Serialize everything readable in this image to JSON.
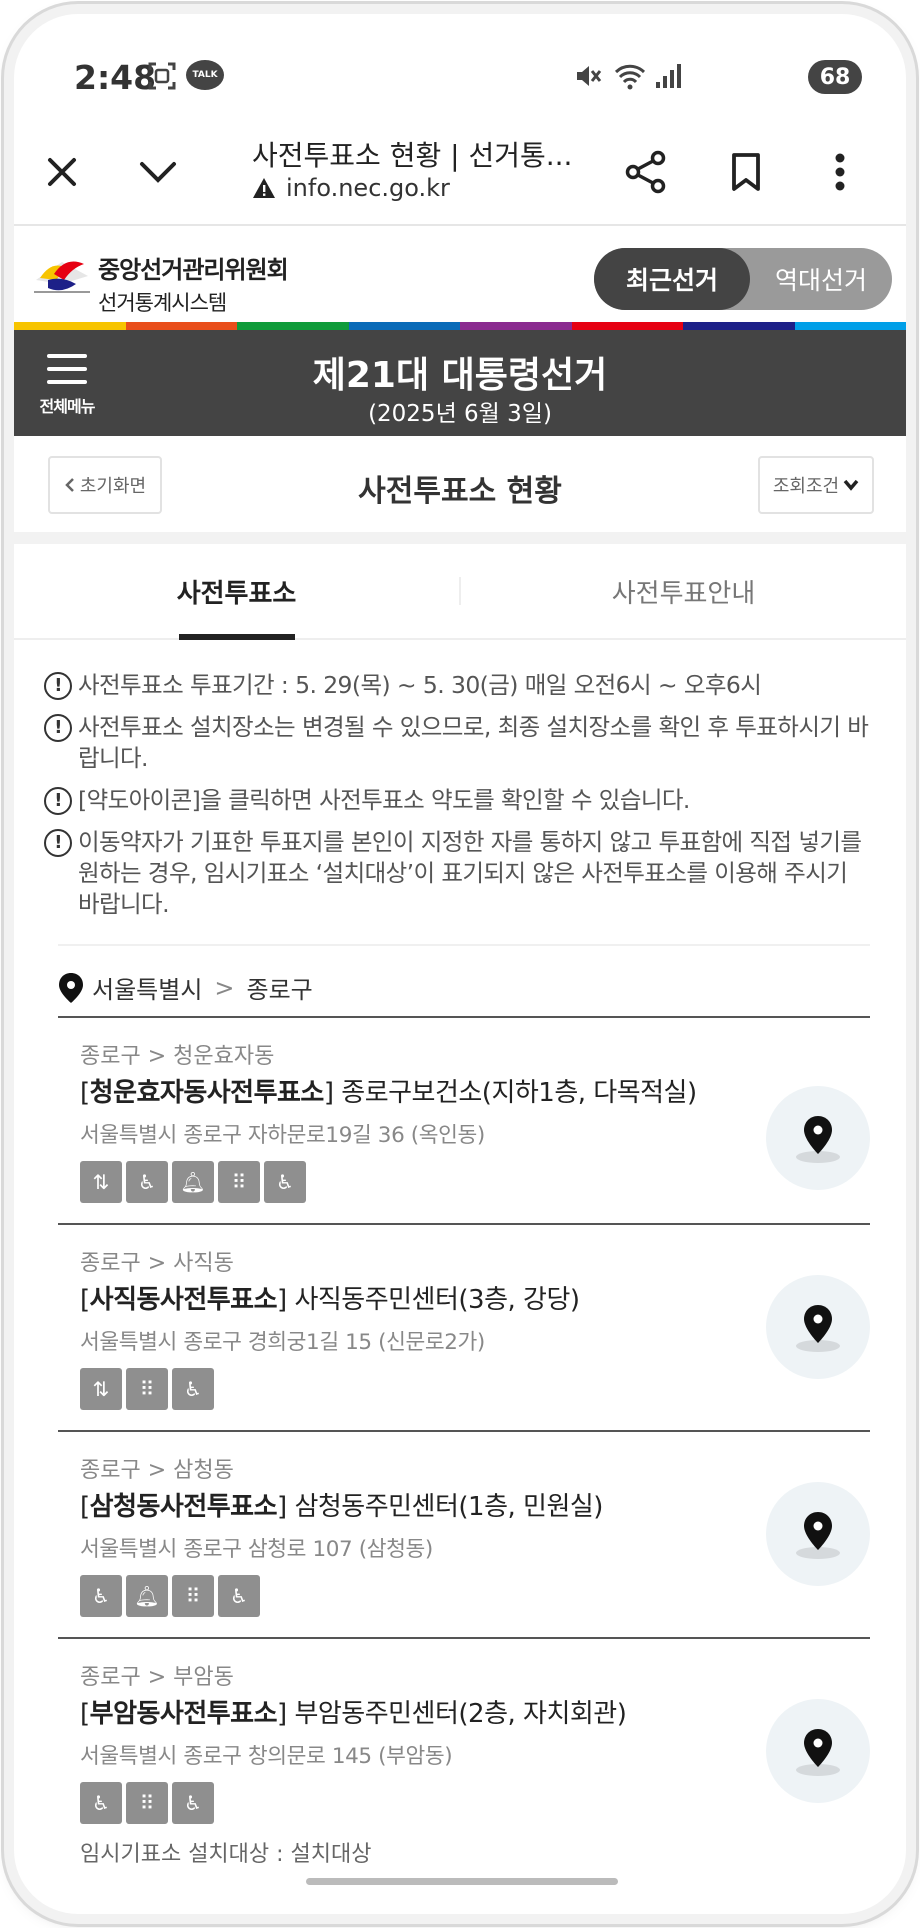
{
  "status_bar": {
    "time": "2:48",
    "talk_badge": "TALK",
    "battery": "68",
    "icons": [
      "screenshot-icon",
      "talk-icon",
      "mute-icon",
      "wifi-icon",
      "signal-icon"
    ]
  },
  "browser": {
    "title": "사전투표소 현황 | 선거통...",
    "url": "info.nec.go.kr"
  },
  "site": {
    "org_name": "중앙선거관리위원회",
    "org_sub": "선거통계시스템",
    "toggle_recent": "최근선거",
    "toggle_past": "역대선거",
    "rainbow_colors": [
      "#f7c400",
      "#e94e1b",
      "#0f9b3a",
      "#0a6bb8",
      "#8a2a8f",
      "#e60012",
      "#1d2088",
      "#009fe8"
    ]
  },
  "banner": {
    "menu_label": "전체메뉴",
    "title": "제21대 대통령선거",
    "date": "(2025년 6월 3일)"
  },
  "page": {
    "home_label": "초기화면",
    "title": "사전투표소 현황",
    "filter_label": "조회조건"
  },
  "tabs": [
    {
      "label": "사전투표소"
    },
    {
      "label": "사전투표안내"
    }
  ],
  "notices": [
    {
      "text": "사전투표소 투표기간 : 5. 29(목) ~ 5. 30(금) 매일 오전6시 ~ 오후6시"
    },
    {
      "text": "사전투표소 설치장소는 변경될 수 있으므로, 최종 설치장소를 확인 후 투표하시기 바랍니다."
    },
    {
      "text": "[약도아이콘]을 클릭하면 사전투표소 약도를 확인할 수 있습니다."
    },
    {
      "text": "이동약자가 기표한 투표지를 본인이 지정한 자를 통하지 않고 투표함에 직접 넣기를 원하는 경우, 임시기표소 ‘설치대상’이 표기되지 않은 사전투표소를 이용해 주시기 바랍니다."
    }
  ],
  "location": {
    "city": "서울특별시",
    "separator": ">",
    "district": "종로구"
  },
  "stations": [
    {
      "crumb": "종로구 > 청운효자동",
      "name": "청운효자동사전투표소",
      "place": "종로구보건소(지하1층, 다목적실)",
      "address": "서울특별시 종로구 자하문로19길 36 (옥인동)"
    },
    {
      "crumb": "종로구 > 사직동",
      "name": "사직동사전투표소",
      "place": "사직동주민센터(3층, 강당)",
      "address": "서울특별시 종로구 경희궁1길 15 (신문로2가)"
    },
    {
      "crumb": "종로구 > 삼청동",
      "name": "삼청동사전투표소",
      "place": "삼청동주민센터(1층, 민원실)",
      "address": "서울특별시 종로구 삼청로 107 (삼청동)"
    },
    {
      "crumb": "종로구 > 부암동",
      "name": "부암동사전투표소",
      "place": "부암동주민센터(2층, 자치회관)",
      "address": "서울특별시 종로구 창의문로 145 (부암동)",
      "extra": "임시기표소 설치대상 : 설치대상"
    }
  ]
}
